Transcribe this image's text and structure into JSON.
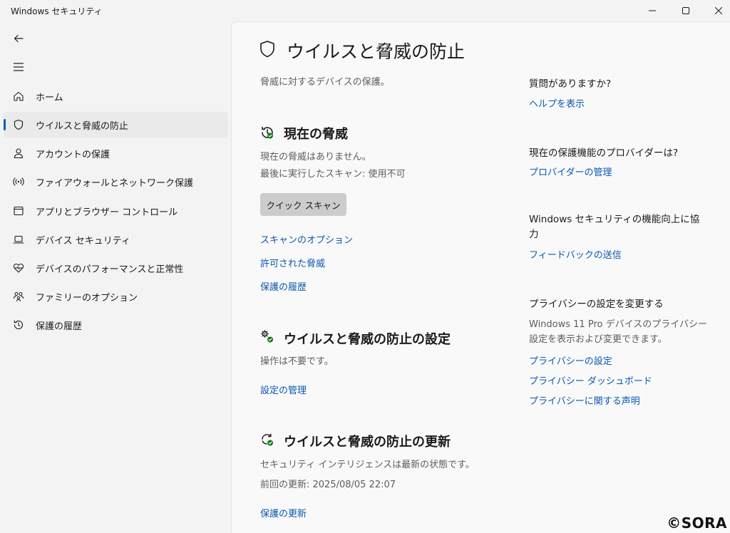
{
  "window": {
    "title": "Windows セキュリティ"
  },
  "sidebar": {
    "items": [
      {
        "label": "ホーム",
        "icon": "home-icon"
      },
      {
        "label": "ウイルスと脅威の防止",
        "icon": "shield-icon",
        "active": true
      },
      {
        "label": "アカウントの保護",
        "icon": "person-icon"
      },
      {
        "label": "ファイアウォールとネットワーク保護",
        "icon": "wifi-antenna-icon"
      },
      {
        "label": "アプリとブラウザー コントロール",
        "icon": "app-browser-icon"
      },
      {
        "label": "デバイス セキュリティ",
        "icon": "laptop-icon"
      },
      {
        "label": "デバイスのパフォーマンスと正常性",
        "icon": "heart-pulse-icon"
      },
      {
        "label": "ファミリーのオプション",
        "icon": "family-icon"
      },
      {
        "label": "保護の履歴",
        "icon": "history-icon"
      }
    ]
  },
  "main": {
    "title": "ウイルスと脅威の防止",
    "subtitle": "脅威に対するデバイスの保護。",
    "current_threats": {
      "heading": "現在の脅威",
      "status": "現在の脅威はありません。",
      "last_scan": "最後に実行したスキャン: 使用不可",
      "quick_scan_label": "クイック スキャン",
      "links": [
        "スキャンのオプション",
        "許可された脅威",
        "保護の履歴"
      ]
    },
    "settings": {
      "heading": "ウイルスと脅威の防止の設定",
      "status": "操作は不要です。",
      "link": "設定の管理"
    },
    "updates": {
      "heading": "ウイルスと脅威の防止の更新",
      "status": "セキュリティ インテリジェンスは最新の状態です。",
      "last_update": "前回の更新: 2025/08/05 22:07",
      "link": "保護の更新"
    }
  },
  "aside": {
    "question": {
      "heading": "質問がありますか?",
      "link": "ヘルプを表示"
    },
    "provider": {
      "heading": "現在の保護機能のプロバイダーは?",
      "link": "プロバイダーの管理"
    },
    "improve": {
      "heading": "Windows セキュリティの機能向上に協力",
      "link": "フィードバックの送信"
    },
    "privacy": {
      "heading": "プライバシーの設定を変更する",
      "text": "Windows 11 Pro デバイスのプライバシー設定を表示および変更できます。",
      "links": [
        "プライバシーの設定",
        "プライバシー ダッシュボード",
        "プライバシーに関する声明"
      ]
    }
  },
  "watermark": "©SORA",
  "colors": {
    "accent": "#005fb8",
    "link": "#0a58b2",
    "status_ok": "#0f7b0f"
  }
}
